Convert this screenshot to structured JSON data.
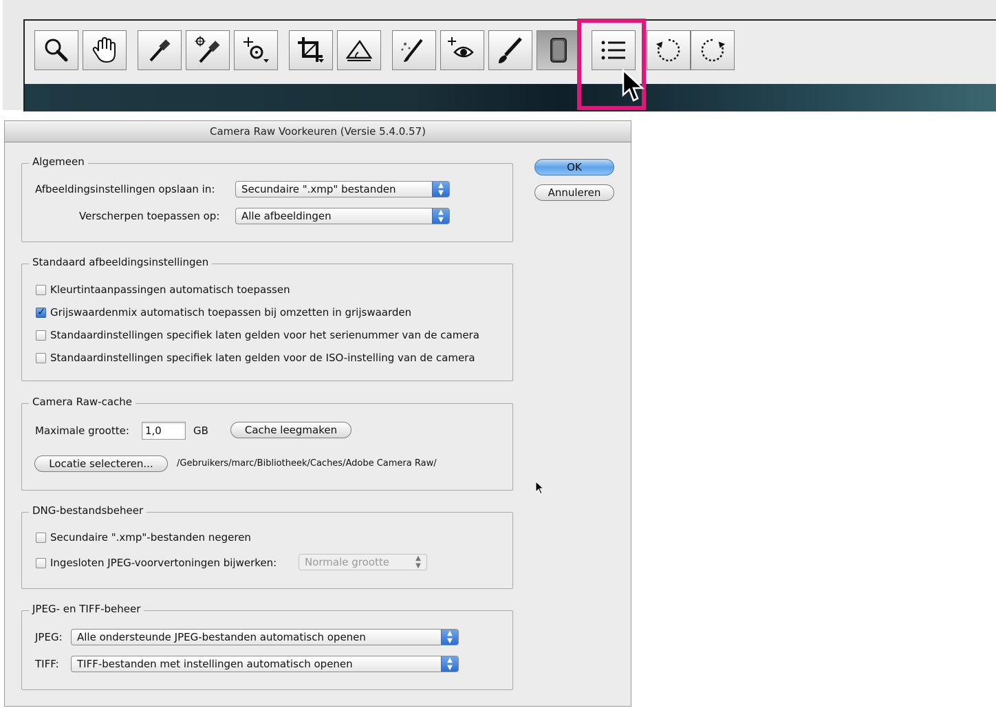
{
  "toolbar": {
    "tools": [
      {
        "icon": "zoom-icon"
      },
      {
        "icon": "hand-icon"
      },
      {
        "icon": "white-balance-icon"
      },
      {
        "icon": "color-sampler-icon"
      },
      {
        "icon": "targeted-adjustment-icon"
      },
      {
        "icon": "crop-icon"
      },
      {
        "icon": "straighten-icon"
      },
      {
        "icon": "spot-removal-icon"
      },
      {
        "icon": "red-eye-icon"
      },
      {
        "icon": "adjustment-brush-icon"
      },
      {
        "icon": "graduated-filter-icon"
      },
      {
        "icon": "preferences-icon"
      },
      {
        "icon": "rotate-left-icon"
      },
      {
        "icon": "rotate-right-icon"
      }
    ],
    "highlight_color": "#e0177a"
  },
  "dialog": {
    "title": "Camera Raw Voorkeuren  (Versie 5.4.0.57)",
    "ok_label": "OK",
    "cancel_label": "Annuleren",
    "general": {
      "legend": "Algemeen",
      "save_settings_label": "Afbeeldingsinstellingen opslaan in:",
      "save_settings_value": "Secundaire \".xmp\" bestanden",
      "sharpen_label": "Verscherpen toepassen op:",
      "sharpen_value": "Alle afbeeldingen"
    },
    "defaults": {
      "legend": "Standaard afbeeldingsinstellingen",
      "options": [
        {
          "label": "Kleurtintaanpassingen automatisch toepassen",
          "checked": false
        },
        {
          "label": "Grijswaardenmix automatisch toepassen bij omzetten in grijswaarden",
          "checked": true
        },
        {
          "label": "Standaardinstellingen specifiek laten gelden voor het serienummer van de camera",
          "checked": false
        },
        {
          "label": "Standaardinstellingen specifiek laten gelden voor de ISO-instelling van de camera",
          "checked": false
        }
      ]
    },
    "cache": {
      "legend": "Camera Raw-cache",
      "max_size_label": "Maximale grootte:",
      "max_size_value": "1,0",
      "unit": "GB",
      "purge_label": "Cache leegmaken",
      "select_location_label": "Locatie selecteren...",
      "path": "/Gebruikers/marc/Bibliotheek/Caches/Adobe Camera Raw/"
    },
    "dng": {
      "legend": "DNG-bestandsbeheer",
      "ignore_xmp_label": "Secundaire \".xmp\"-bestanden negeren",
      "ignore_xmp_checked": false,
      "update_previews_label": "Ingesloten JPEG-voorvertoningen bijwerken:",
      "update_previews_checked": false,
      "preview_size_value": "Normale grootte"
    },
    "jpeg_tiff": {
      "legend": "JPEG- en TIFF-beheer",
      "jpeg_label": "JPEG:",
      "jpeg_value": "Alle ondersteunde JPEG-bestanden automatisch openen",
      "tiff_label": "TIFF:",
      "tiff_value": "TIFF-bestanden met instellingen automatisch openen"
    }
  }
}
